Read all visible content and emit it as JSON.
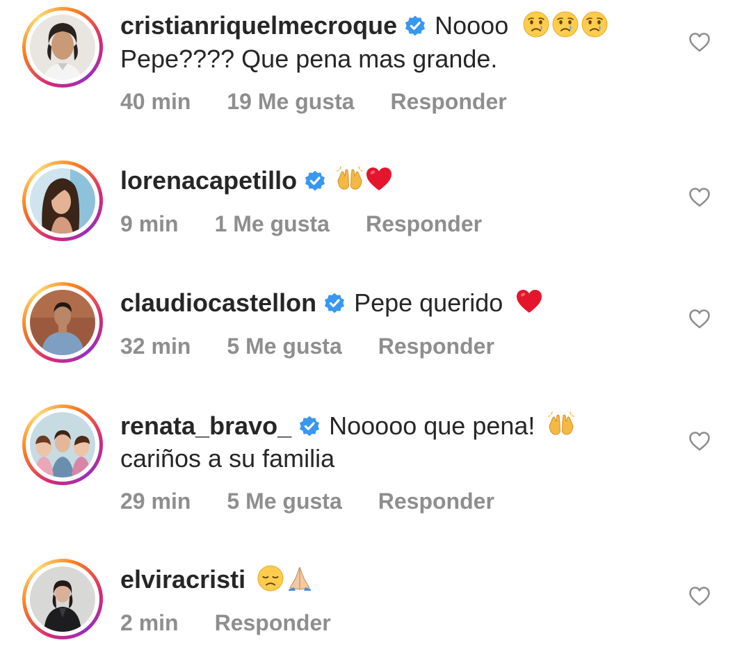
{
  "comments": [
    {
      "username": "cristianriquelmecroque",
      "verified": true,
      "text": "Noooo",
      "emojis": [
        "crying-face-emoji",
        "crying-face-emoji",
        "crying-face-emoji"
      ],
      "text_line2": "Pepe???? Que pena mas grande.",
      "time": "40 min",
      "likes": "19 Me gusta",
      "reply": "Responder"
    },
    {
      "username": "lorenacapetillo",
      "verified": true,
      "text": "",
      "emojis": [
        "raising-hands-emoji",
        "red-heart-emoji"
      ],
      "time": "9 min",
      "likes": "1 Me gusta",
      "reply": "Responder"
    },
    {
      "username": "claudiocastellon",
      "verified": true,
      "text": "Pepe querido",
      "emojis": [
        "red-heart-emoji"
      ],
      "time": "32 min",
      "likes": "5 Me gusta",
      "reply": "Responder"
    },
    {
      "username": "renata_bravo_",
      "verified": true,
      "text": "Nooooo que pena!",
      "emojis": [
        "raising-hands-emoji"
      ],
      "text_line2": "cariños a su familia",
      "time": "29 min",
      "likes": "5 Me gusta",
      "reply": "Responder"
    },
    {
      "username": "elviracristi",
      "verified": false,
      "text": "",
      "emojis": [
        "disappointed-face-emoji",
        "folded-hands-emoji"
      ],
      "time": "2 min",
      "reply": "Responder"
    }
  ],
  "colors": {
    "text": "#262626",
    "meta": "#8e8e8e",
    "verified_blue": "#3897f0",
    "heart_outline": "#8e8e8e"
  }
}
